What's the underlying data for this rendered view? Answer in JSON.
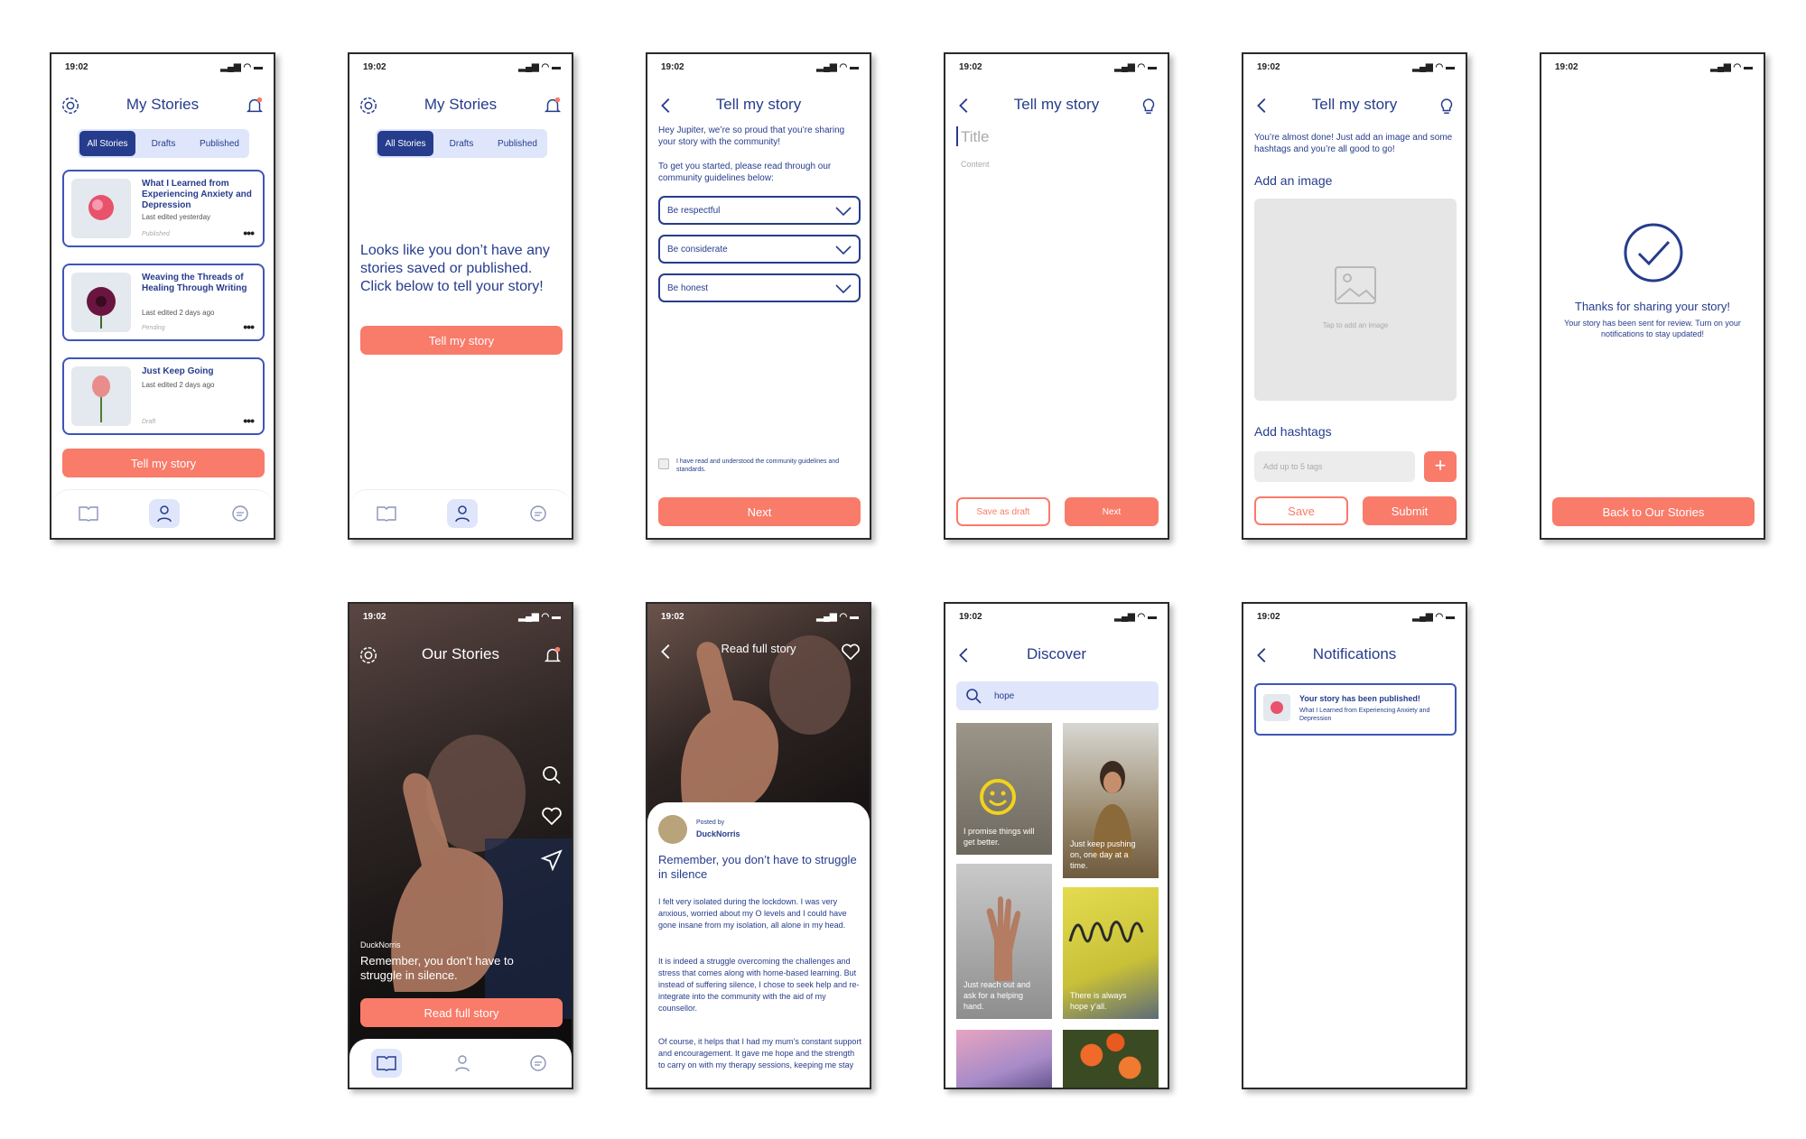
{
  "status": {
    "time": "19:02",
    "icons": "▂▄▆ ◠ ▬"
  },
  "s1": {
    "title": "My Stories",
    "seg": [
      "All Stories",
      "Drafts",
      "Published"
    ],
    "cards": [
      {
        "title": "What I Learned from Experiencing Anxiety and Depression",
        "meta": "Last edited yesterday",
        "status": "Published"
      },
      {
        "title": "Weaving the Threads of Healing Through Writing",
        "meta": "Last edited 2 days ago",
        "status": "Pending"
      },
      {
        "title": "Just Keep Going",
        "meta": "Last edited 2 days ago",
        "status": "Draft"
      }
    ],
    "more": "•••",
    "cta": "Tell my story"
  },
  "s2": {
    "title": "My Stories",
    "seg": [
      "All Stories",
      "Drafts",
      "Published"
    ],
    "message": "Looks like you don’t have any stories saved or published. Click below to tell your story!",
    "cta": "Tell my story"
  },
  "s3": {
    "title": "Tell my story",
    "intro1": "Hey Jupiter, we’re so proud that you’re sharing your story with the community!",
    "intro2": "To get you started, please read through our community guidelines below:",
    "guides": [
      "Be respectful",
      "Be considerate",
      "Be honest"
    ],
    "check": "I have read and understood the community guidelines and standards.",
    "next": "Next"
  },
  "s4": {
    "title": "Tell my story",
    "title_ph": "Title",
    "content_ph": "Content",
    "draft": "Save as draft",
    "next": "Next"
  },
  "s5": {
    "title": "Tell my story",
    "intro": "You’re almost done! Just add an image and some hashtags and you’re all good to go!",
    "add_image": "Add an image",
    "tap": "Tap to add an image",
    "add_tags": "Add hashtags",
    "tags_ph": "Add up to 5 tags",
    "plus": "+",
    "save": "Save",
    "submit": "Submit"
  },
  "s6": {
    "heading": "Thanks for sharing your story!",
    "text": "Your story has been sent for review. Turn on your notifications to stay updated!",
    "cta": "Back to Our Stories"
  },
  "s7": {
    "title": "Our Stories",
    "author": "DuckNorris",
    "quote": "Remember, you don’t have to struggle in silence.",
    "cta": "Read full story"
  },
  "s8": {
    "title": "Read full story",
    "posted": "Posted by",
    "author": "DuckNorris",
    "headline": "Remember, you don’t have to struggle in silence",
    "p1": "I felt very isolated during the lockdown. I was very anxious, worried about my O levels and I could have gone insane from my isolation, all alone in my head.",
    "p2": "It is indeed a struggle overcoming the challenges and stress that comes along with home-based learning. But instead of suffering silence, I chose to seek help and re-integrate into the community with the aid of my counsellor.",
    "p3": "Of course, it helps that I had my mum’s constant support and encouragement. It gave me hope and the strength to carry on with my therapy sessions, keeping me stay"
  },
  "s9": {
    "title": "Discover",
    "search": "hope",
    "captions": [
      "I promise things will get better.",
      "Just keep pushing on, one day at a time.",
      "Just reach out and ask for a helping hand.",
      "There is always hope y’all."
    ]
  },
  "s10": {
    "title": "Notifications",
    "notif_title": "Your story has been published!",
    "notif_sub": "What I Learned from Experiencing Anxiety and Depression"
  }
}
